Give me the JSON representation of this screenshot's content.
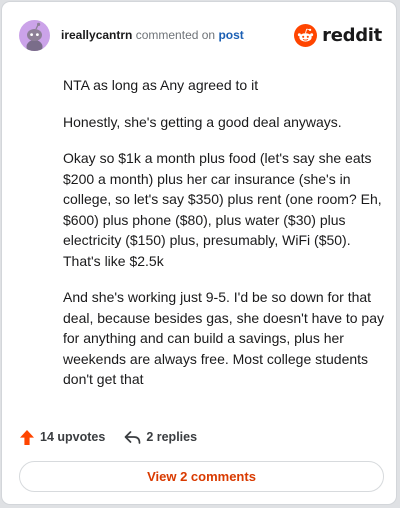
{
  "header": {
    "username": "ireallycantrn",
    "action_text": "commented on",
    "post_link": "post",
    "brand": "reddit"
  },
  "comment": {
    "paragraphs": [
      "NTA as long as Any agreed to it",
      "Honestly, she's getting a good deal anyways.",
      "Okay so $1k a month plus food (let's say she eats $200 a month) plus her car insurance (she's in college, so let's say $350) plus rent (one room? Eh, $600) plus phone ($80), plus water ($30) plus electricity ($150) plus, presumably, WiFi ($50). That's like $2.5k",
      "And she's working just 9-5. I'd be so down for that deal, because besides gas, she doesn't have to pay for anything and can build a savings, plus her weekends are always free. Most college students don't get that"
    ]
  },
  "footer": {
    "upvotes": "14 upvotes",
    "replies": "2 replies",
    "view_comments": "View 2 comments"
  },
  "colors": {
    "brand_orange": "#ff4500",
    "link_blue": "#1a5fb4",
    "view_button_text": "#d93a00",
    "avatar_bg": "#cba3e9"
  },
  "icons": {
    "avatar": "snoo-avatar-icon",
    "brand": "reddit-logo-icon",
    "upvote": "upvote-arrow-icon",
    "reply": "reply-arrow-icon"
  }
}
